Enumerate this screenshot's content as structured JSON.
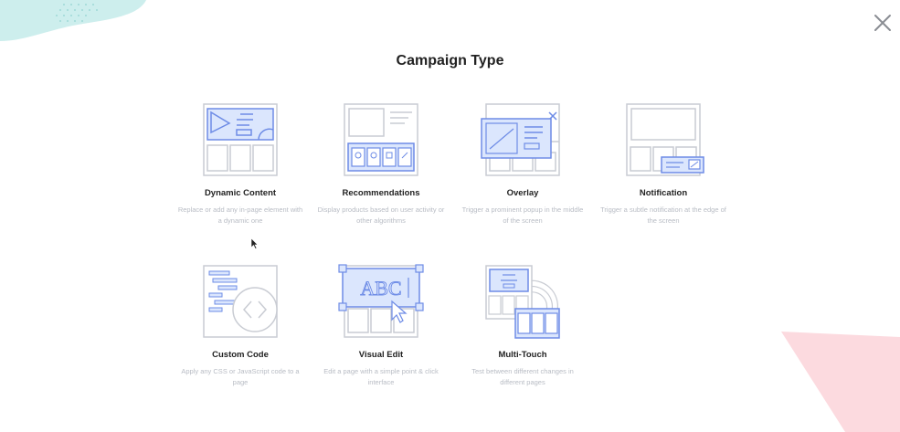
{
  "modal": {
    "title": "Campaign Type",
    "close_icon": "close-icon"
  },
  "colors": {
    "accent_fill": "#dbe6fd",
    "accent_stroke": "#6e8ce6",
    "line_gray": "#c9ccd3",
    "desc_text": "#b8bcc4",
    "deco_teal": "#cdeeed",
    "deco_pink": "#fcdadf"
  },
  "campaign_types": [
    {
      "icon": "dynamic-content-icon",
      "title": "Dynamic Content",
      "description": "Replace or add any in-page element with a dynamic one"
    },
    {
      "icon": "recommendations-icon",
      "title": "Recommendations",
      "description": "Display products based on user activity or other algorithms"
    },
    {
      "icon": "overlay-icon",
      "title": "Overlay",
      "description": "Trigger a prominent popup in the middle of the screen"
    },
    {
      "icon": "notification-icon",
      "title": "Notification",
      "description": "Trigger a subtle notification at the edge of the screen"
    },
    {
      "icon": "custom-code-icon",
      "title": "Custom Code",
      "description": "Apply any CSS or JavaScript code to a page"
    },
    {
      "icon": "visual-edit-icon",
      "title": "Visual Edit",
      "description": "Edit a page with a simple point & click interface"
    },
    {
      "icon": "multi-touch-icon",
      "title": "Multi-Touch",
      "description": "Test between different changes in different pages"
    }
  ],
  "visual_edit_sample_text": "ABC"
}
